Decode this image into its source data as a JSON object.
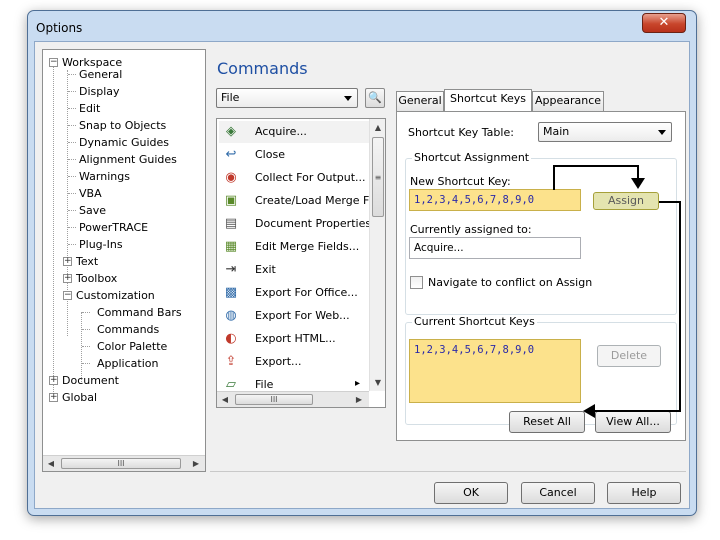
{
  "window": {
    "title": "Options",
    "close_glyph": "✕"
  },
  "tree": {
    "items": [
      {
        "label": "Workspace",
        "expander": "−"
      },
      {
        "label": "General"
      },
      {
        "label": "Display"
      },
      {
        "label": "Edit"
      },
      {
        "label": "Snap to Objects"
      },
      {
        "label": "Dynamic Guides"
      },
      {
        "label": "Alignment Guides"
      },
      {
        "label": "Warnings"
      },
      {
        "label": "VBA"
      },
      {
        "label": "Save"
      },
      {
        "label": "PowerTRACE"
      },
      {
        "label": "Plug-Ins"
      },
      {
        "label": "Text",
        "expander": "+"
      },
      {
        "label": "Toolbox",
        "expander": "+"
      },
      {
        "label": "Customization",
        "expander": "−"
      },
      {
        "label": "Command Bars"
      },
      {
        "label": "Commands"
      },
      {
        "label": "Color Palette"
      },
      {
        "label": "Application"
      },
      {
        "label": "Document",
        "expander": "+"
      },
      {
        "label": "Global",
        "expander": "+"
      }
    ],
    "scroll_thumb": "III"
  },
  "commands": {
    "heading": "Commands",
    "category": "File",
    "find_glyph": "🔍",
    "items": [
      {
        "label": "Acquire...",
        "icon": "acquire-icon",
        "glyph": "◈"
      },
      {
        "label": "Close",
        "icon": "close-doc-icon",
        "glyph": "↩"
      },
      {
        "label": "Collect For Output...",
        "icon": "collect-output-icon",
        "glyph": "◉"
      },
      {
        "label": "Create/Load Merge Fie",
        "icon": "merge-create-icon",
        "glyph": "▣"
      },
      {
        "label": "Document Properties...",
        "icon": "doc-properties-icon",
        "glyph": "▤"
      },
      {
        "label": "Edit Merge Fields...",
        "icon": "merge-edit-icon",
        "glyph": "▦"
      },
      {
        "label": "Exit",
        "icon": "exit-icon",
        "glyph": "⇥"
      },
      {
        "label": "Export For Office...",
        "icon": "export-office-icon",
        "glyph": "▩"
      },
      {
        "label": "Export For Web...",
        "icon": "export-web-icon",
        "glyph": "◍"
      },
      {
        "label": "Export HTML...",
        "icon": "export-html-icon",
        "glyph": "◐"
      },
      {
        "label": "Export...",
        "icon": "export-icon",
        "glyph": "⇪"
      },
      {
        "label": "File",
        "icon": "file-icon",
        "glyph": "▱",
        "submenu": "▸"
      }
    ],
    "scroll_thumb": "III"
  },
  "tabs": [
    {
      "label": "General"
    },
    {
      "label": "Shortcut Keys"
    },
    {
      "label": "Appearance"
    }
  ],
  "shortcut": {
    "table_label": "Shortcut Key Table:",
    "table_value": "Main",
    "assignment_group": "Shortcut Assignment",
    "new_key_label": "New Shortcut Key:",
    "new_key_value": "1,2,3,4,5,6,7,8,9,0",
    "assign_label": "Assign",
    "assigned_label": "Currently assigned to:",
    "assigned_value": "Acquire...",
    "navigate_label": "Navigate to conflict on Assign",
    "current_group": "Current Shortcut Keys",
    "current_value": "1,2,3,4,5,6,7,8,9,0",
    "delete_label": "Delete",
    "reset_label": "Reset All",
    "view_label": "View All..."
  },
  "footer": {
    "ok": "OK",
    "cancel": "Cancel",
    "help": "Help"
  },
  "colors": {
    "highlight": "#fce28c",
    "heading": "#1e4fa3",
    "assign_button": "#e4e4b0"
  }
}
